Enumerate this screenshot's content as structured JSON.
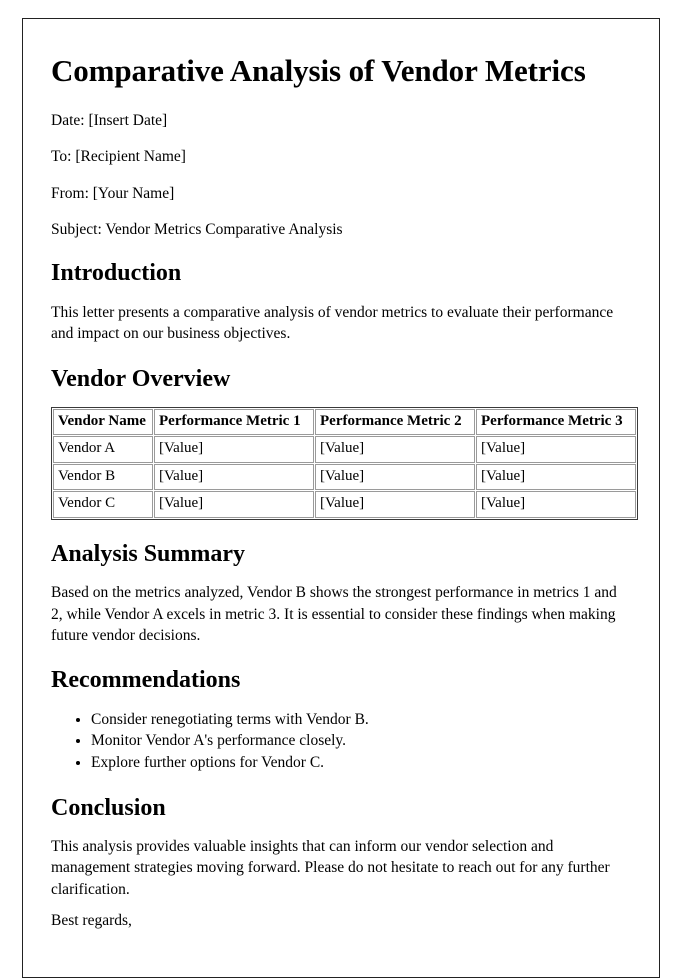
{
  "document": {
    "title": "Comparative Analysis of Vendor Metrics",
    "meta": {
      "date": "Date: [Insert Date]",
      "to": "To: [Recipient Name]",
      "from": "From: [Your Name]",
      "subject": "Subject: Vendor Metrics Comparative Analysis"
    },
    "sections": {
      "introduction": {
        "heading": "Introduction",
        "paragraph": "This letter presents a comparative analysis of vendor metrics to evaluate their performance and impact on our business objectives."
      },
      "vendor_overview": {
        "heading": "Vendor Overview",
        "table": {
          "columns": [
            "Vendor Name",
            "Performance Metric 1",
            "Performance Metric 2",
            "Performance Metric 3"
          ],
          "rows": [
            [
              "Vendor A",
              "[Value]",
              "[Value]",
              "[Value]"
            ],
            [
              "Vendor B",
              "[Value]",
              "[Value]",
              "[Value]"
            ],
            [
              "Vendor C",
              "[Value]",
              "[Value]",
              "[Value]"
            ]
          ]
        }
      },
      "analysis_summary": {
        "heading": "Analysis Summary",
        "paragraph": "Based on the metrics analyzed, Vendor B shows the strongest performance in metrics 1 and 2, while Vendor A excels in metric 3. It is essential to consider these findings when making future vendor decisions."
      },
      "recommendations": {
        "heading": "Recommendations",
        "items": [
          "Consider renegotiating terms with Vendor B.",
          "Monitor Vendor A's performance closely.",
          "Explore further options for Vendor C."
        ]
      },
      "conclusion": {
        "heading": "Conclusion",
        "paragraph": "This analysis provides valuable insights that can inform our vendor selection and management strategies moving forward. Please do not hesitate to reach out for any further clarification.",
        "signoff": "Best regards,"
      }
    }
  }
}
